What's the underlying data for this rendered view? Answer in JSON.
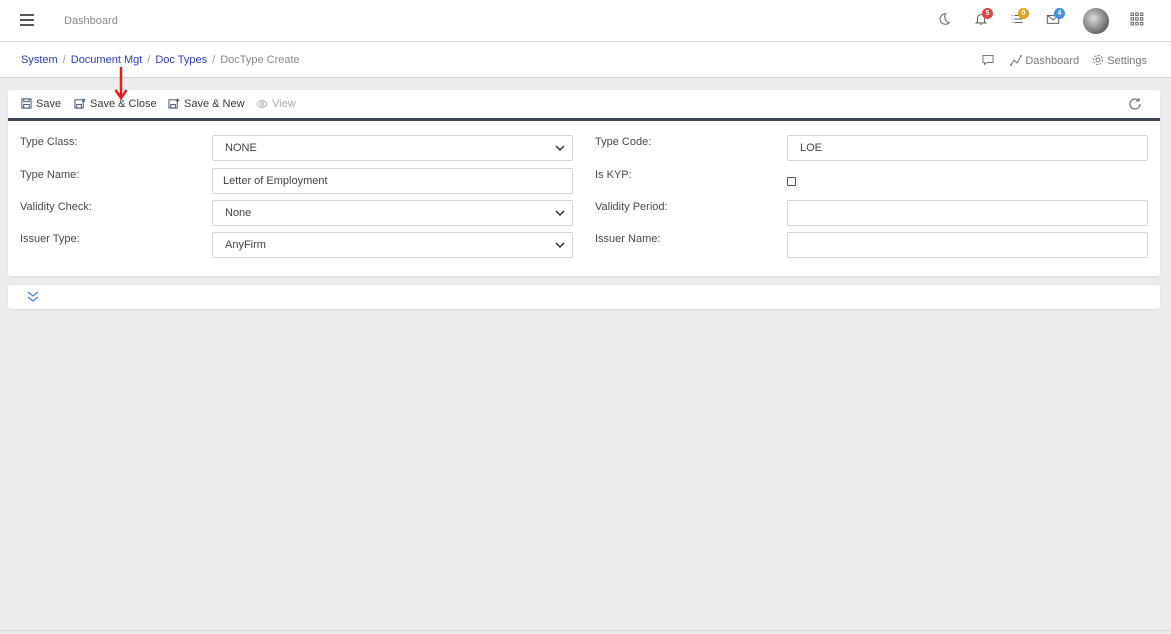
{
  "header": {
    "title": "Dashboard",
    "notifications_count": "5",
    "tasks_count": "0",
    "messages_count": "4",
    "badge_colors": {
      "notifications": "#e04545",
      "tasks": "#e6a21a",
      "messages": "#3d8fe0"
    }
  },
  "breadcrumb": {
    "items": [
      "System",
      "Document Mgt",
      "Doc Types"
    ],
    "current": "DocType Create",
    "separator": "/"
  },
  "breadbar_right": {
    "dashboard": "Dashboard",
    "settings": "Settings"
  },
  "toolbar": {
    "save": "Save",
    "save_close": "Save & Close",
    "save_new": "Save & New",
    "view": "View"
  },
  "form": {
    "type_class": {
      "label": "Type Class:",
      "value": "NONE"
    },
    "type_code": {
      "label": "Type Code:",
      "value": "LOE"
    },
    "type_name": {
      "label": "Type Name:",
      "value": "Letter of Employment"
    },
    "is_kyp": {
      "label": "Is KYP:",
      "checked": false
    },
    "validity_check": {
      "label": "Validity Check:",
      "value": "None"
    },
    "validity_period": {
      "label": "Validity Period:",
      "value": ""
    },
    "issuer_type": {
      "label": "Issuer Type:",
      "value": "AnyFirm"
    },
    "issuer_name": {
      "label": "Issuer Name:",
      "value": ""
    }
  },
  "colors": {
    "link": "#2b3cc5",
    "toolbar_border": "#3a4452",
    "annotation_arrow": "#e02020"
  }
}
